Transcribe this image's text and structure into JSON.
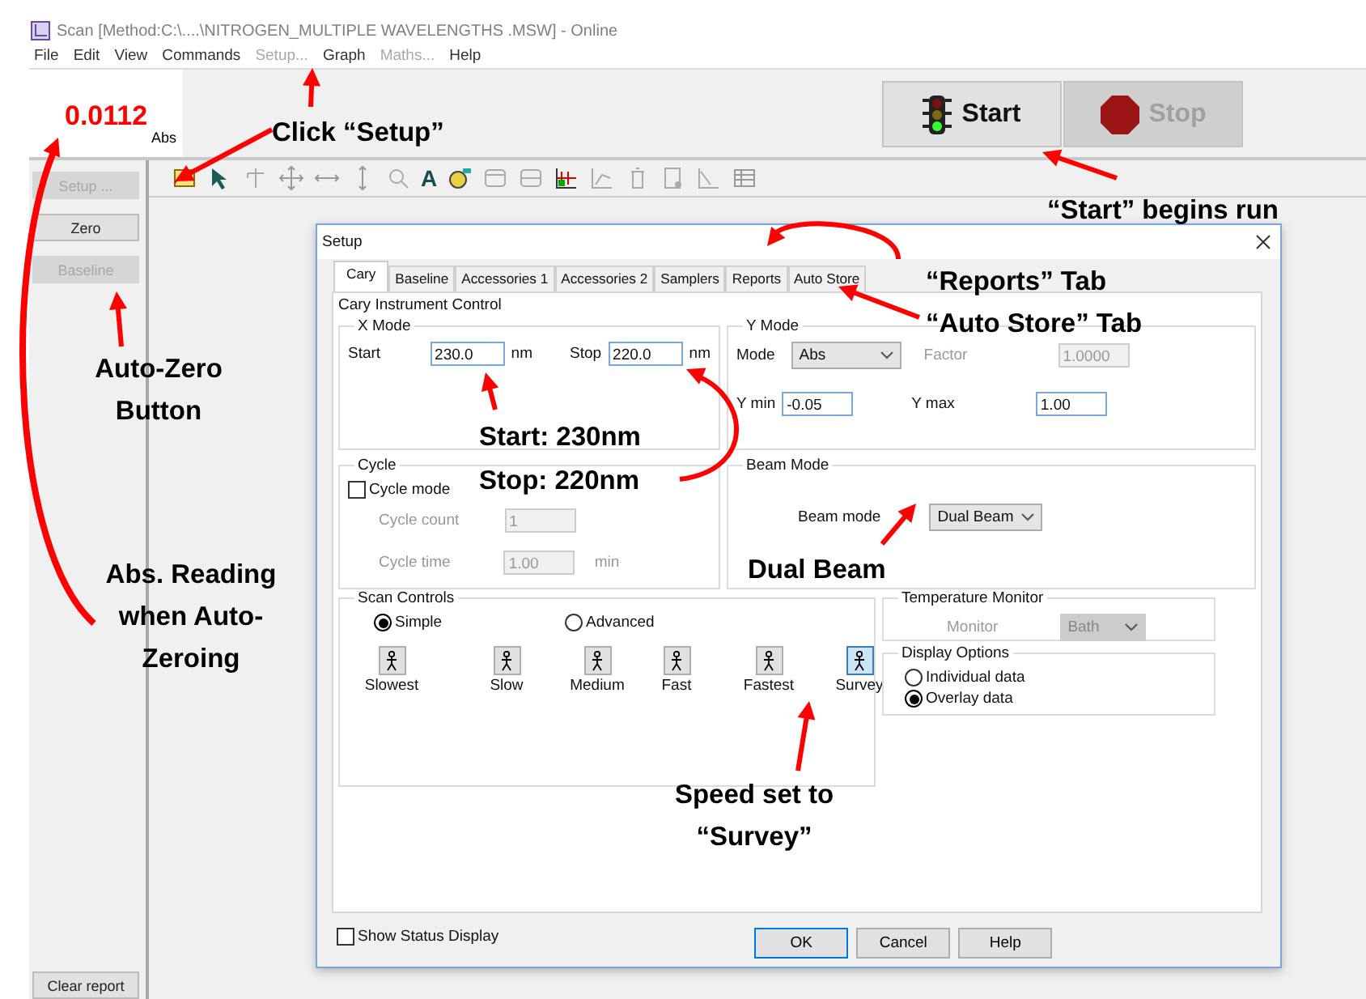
{
  "window": {
    "title": "Scan [Method:C:\\....\\NITROGEN_MULTIPLE WAVELENGTHS .MSW] - Online"
  },
  "menu": [
    {
      "label": "File",
      "disabled": false
    },
    {
      "label": "Edit",
      "disabled": false
    },
    {
      "label": "View",
      "disabled": false
    },
    {
      "label": "Commands",
      "disabled": false
    },
    {
      "label": "Setup...",
      "disabled": true
    },
    {
      "label": "Graph",
      "disabled": false
    },
    {
      "label": "Maths...",
      "disabled": true
    },
    {
      "label": "Help",
      "disabled": false
    }
  ],
  "reading": {
    "value": "0.0112",
    "unit": "Abs"
  },
  "run_buttons": [
    {
      "kind": "start",
      "label": "Start",
      "disabled": false
    },
    {
      "kind": "stop",
      "label": "Stop",
      "disabled": true
    }
  ],
  "side_buttons": [
    {
      "label": "Setup ...",
      "disabled": true
    },
    {
      "label": "Zero",
      "disabled": false
    },
    {
      "label": "Baseline",
      "disabled": true
    }
  ],
  "clear_button": {
    "label": "Clear report"
  },
  "toolbar": {
    "font_button": "A"
  },
  "dialog": {
    "title": "Setup",
    "tabs": [
      {
        "label": "Cary",
        "selected": true
      },
      {
        "label": "Baseline",
        "selected": false
      },
      {
        "label": "Accessories 1",
        "selected": false
      },
      {
        "label": "Accessories 2",
        "selected": false
      },
      {
        "label": "Samplers",
        "selected": false
      },
      {
        "label": "Reports",
        "selected": false
      },
      {
        "label": "Auto Store",
        "selected": false
      }
    ],
    "heading": "Cary Instrument Control",
    "x_mode": {
      "title": "X Mode",
      "start": {
        "label": "Start",
        "value": "230.0",
        "unit": "nm"
      },
      "stop": {
        "label": "Stop",
        "value": "220.0",
        "unit": "nm"
      }
    },
    "y_mode": {
      "title": "Y Mode",
      "mode": {
        "label": "Mode",
        "value": "Abs"
      },
      "factor": {
        "label": "Factor",
        "value": "1.0000",
        "disabled": true
      },
      "y_min": {
        "label": "Y min",
        "value": "-0.05"
      },
      "y_max": {
        "label": "Y max",
        "value": "1.00"
      }
    },
    "cycle": {
      "title": "Cycle",
      "cycle_mode": {
        "label": "Cycle mode",
        "checked": false
      },
      "count": {
        "label": "Cycle count",
        "value": "1",
        "disabled": true
      },
      "time": {
        "label": "Cycle time",
        "value": "1.00",
        "unit": "min",
        "disabled": true
      }
    },
    "beam_mode": {
      "title": "Beam Mode",
      "label": "Beam mode",
      "value": "Dual Beam"
    },
    "scan_controls": {
      "title": "Scan Controls",
      "modes": [
        {
          "label": "Simple",
          "selected": true
        },
        {
          "label": "Advanced",
          "selected": false
        }
      ],
      "speeds": [
        {
          "label": "Slowest",
          "selected": false
        },
        {
          "label": "Slow",
          "selected": false
        },
        {
          "label": "Medium",
          "selected": false
        },
        {
          "label": "Fast",
          "selected": false
        },
        {
          "label": "Fastest",
          "selected": false
        },
        {
          "label": "Survey",
          "selected": true
        }
      ]
    },
    "temperature_monitor": {
      "title": "Temperature Monitor",
      "label": "Monitor",
      "value": "Bath",
      "disabled": true
    },
    "display_options": {
      "title": "Display Options",
      "options": [
        {
          "label": "Individual data",
          "selected": false
        },
        {
          "label": "Overlay data",
          "selected": true
        }
      ]
    },
    "show_status": {
      "label": "Show Status Display",
      "checked": false
    },
    "buttons": [
      {
        "label": "OK",
        "default": true
      },
      {
        "label": "Cancel",
        "default": false
      },
      {
        "label": "Help",
        "default": false
      }
    ]
  },
  "annotations": [
    "Click “Setup”",
    "“Start” begins run",
    "“Reports” Tab",
    "“Auto Store” Tab",
    "Auto-Zero Button",
    "Start: 230nm",
    "Stop: 220nm",
    "Abs. Reading when Auto-Zeroing",
    "Dual Beam",
    "Speed set to “Survey”"
  ]
}
